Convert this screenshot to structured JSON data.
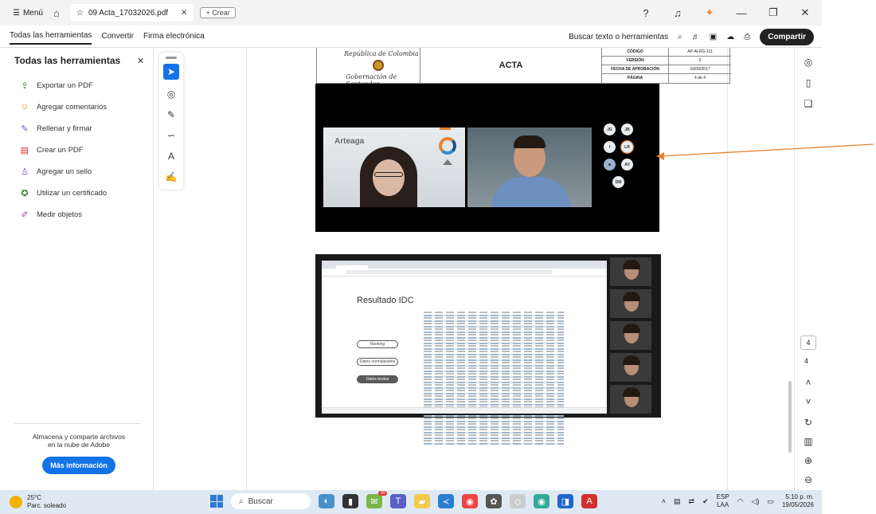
{
  "titlebar": {
    "menu_label": "Menú",
    "tab_title": "09 Acta_17032026.pdf",
    "new_tab_label": "+ Crear"
  },
  "toolbar": {
    "items": [
      "Todas las herramientas",
      "Convertir",
      "Firma electrónica"
    ],
    "search_label": "Buscar texto o herramientas",
    "share_label": "Compartir"
  },
  "left_panel": {
    "title": "Todas las herramientas",
    "tools": [
      {
        "label": "Exportar un PDF",
        "icon": "export-pdf-icon",
        "color": "#2e7d32"
      },
      {
        "label": "Agregar comentarios",
        "icon": "comment-icon",
        "color": "#e6a300"
      },
      {
        "label": "Rellenar y firmar",
        "icon": "fill-sign-icon",
        "color": "#7b4fc9"
      },
      {
        "label": "Crear un PDF",
        "icon": "create-pdf-icon",
        "color": "#d32f2f"
      },
      {
        "label": "Agregar un sello",
        "icon": "stamp-icon",
        "color": "#7b4fc9"
      },
      {
        "label": "Utilizar un certificado",
        "icon": "certificate-icon",
        "color": "#2e7d32"
      },
      {
        "label": "Medir objetos",
        "icon": "ruler-icon",
        "color": "#c0398a"
      }
    ],
    "store_text_1": "Almacena y comparte archivos",
    "store_text_2": "en la nube de Adobe",
    "more_info_label": "Más información"
  },
  "document": {
    "header": {
      "seal_line_1": "República de Colombia",
      "seal_line_2": "Gobernación de Santander",
      "title": "ACTA",
      "rows": [
        {
          "key": "CÓDIGO",
          "value": "AP-AI-RG-111"
        },
        {
          "key": "VERSIÓN",
          "value": "5"
        },
        {
          "key": "FECHA DE APROBACIÓN",
          "value": "16/09/2017"
        },
        {
          "key": "PÁGINA",
          "value": "4 de 4"
        }
      ]
    },
    "meeting_image": {
      "video_label": "Arteaga",
      "participants": [
        "JG",
        "JB",
        "I",
        "LR",
        "",
        "AV",
        "DM"
      ]
    },
    "sheet_image": {
      "title": "Resultado IDC",
      "buttons": [
        "Ranking",
        "Datos normalizados",
        "Datos brutos"
      ]
    }
  },
  "right_pane": {
    "current_page": "4",
    "total_pages": "4"
  },
  "taskbar": {
    "temperature": "25°C",
    "weather": "Parc. soleado",
    "search_label": "Buscar",
    "notification_badge": "30",
    "language": "ESP",
    "layout": "LAA",
    "time": "5:10 p. m.",
    "date": "19/05/2026"
  },
  "colors": {
    "accent": "#1473e6",
    "annotation_arrow": "#e9822e"
  }
}
